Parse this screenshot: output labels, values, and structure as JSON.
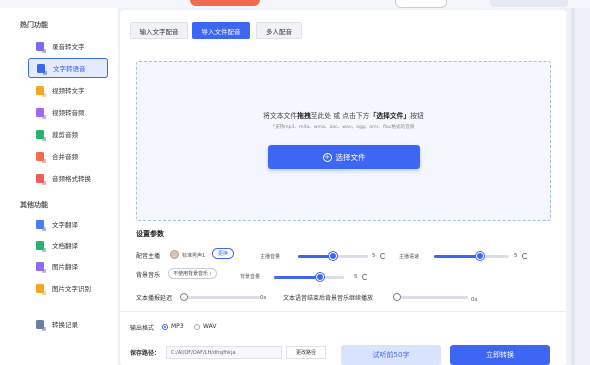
{
  "sidebar": {
    "section1_title": "热门功能",
    "items": [
      {
        "label": "录音转文字",
        "icon": "audio-to-text-icon",
        "color": "#7b6cf0"
      },
      {
        "label": "文字转语音",
        "icon": "text-to-speech-icon",
        "color": "#3d66f2",
        "active": true
      },
      {
        "label": "视频转文字",
        "icon": "video-to-text-icon",
        "color": "#f5a623"
      },
      {
        "label": "视频转音频",
        "icon": "video-to-audio-icon",
        "color": "#9b6cf0"
      },
      {
        "label": "裁剪音频",
        "icon": "cut-audio-icon",
        "color": "#27b36b"
      },
      {
        "label": "合并音频",
        "icon": "merge-audio-icon",
        "color": "#f36b4f"
      },
      {
        "label": "音频格式转换",
        "icon": "audio-format-icon",
        "color": "#f15a5a"
      }
    ],
    "section2_title": "其他功能",
    "items2": [
      {
        "label": "文字翻译",
        "icon": "text-translate-icon",
        "color": "#4c7cf3"
      },
      {
        "label": "文档翻译",
        "icon": "doc-translate-icon",
        "color": "#27b36b"
      },
      {
        "label": "图片翻译",
        "icon": "image-translate-icon",
        "color": "#8d6cf0"
      },
      {
        "label": "图片文字识别",
        "icon": "ocr-icon",
        "color": "#f5a623"
      }
    ],
    "history": {
      "label": "转换记录",
      "icon": "history-icon",
      "color": "#6a7fa8"
    }
  },
  "tabs": [
    "输入文字配音",
    "导入文件配音",
    "多人配音"
  ],
  "active_tab": 1,
  "dropzone": {
    "text_pre": "将文本文件",
    "text_bold1": "拖拽",
    "text_mid": "至此处 或 点击下方",
    "text_bold2": "「选择文件」",
    "text_post": "按钮",
    "hint": "*支持mp3、m4a、wma、aac、wav、ogg、amr、flac格式的音频",
    "button": "选择文件"
  },
  "params": {
    "title": "设置参数",
    "anchor_label": "配音主播",
    "anchor_name": "标准男声1",
    "change_btn": "更换",
    "anchor_volume_label": "主播音量",
    "anchor_volume_value": "5",
    "anchor_speed_label": "主播语速",
    "anchor_speed_value": "5",
    "bgm_label": "背景音乐",
    "bgm_value": "不使用背景音乐",
    "bgm_volume_label": "背景音量",
    "bgm_volume_value": "5",
    "delay_label": "文本播报延迟",
    "delay_value": "0s",
    "continue_label": "文本语音结束后背景音乐继续播放",
    "continue_value": "0s"
  },
  "slider_levels": {
    "anchor_volume": 0.5,
    "anchor_speed": 0.5,
    "bgm_volume": 0.5,
    "delay": 0,
    "continue": 0
  },
  "output": {
    "format_label": "输出格式",
    "options": [
      "MP3",
      "WAV"
    ],
    "selected": "MP3",
    "save_label": "保存路径：",
    "save_path": "C:/Al/OF/OAF/LH/dhsjfhkja",
    "change_path": "更改路径",
    "preview_btn": "试听前50字",
    "convert_btn": "立即转换"
  }
}
